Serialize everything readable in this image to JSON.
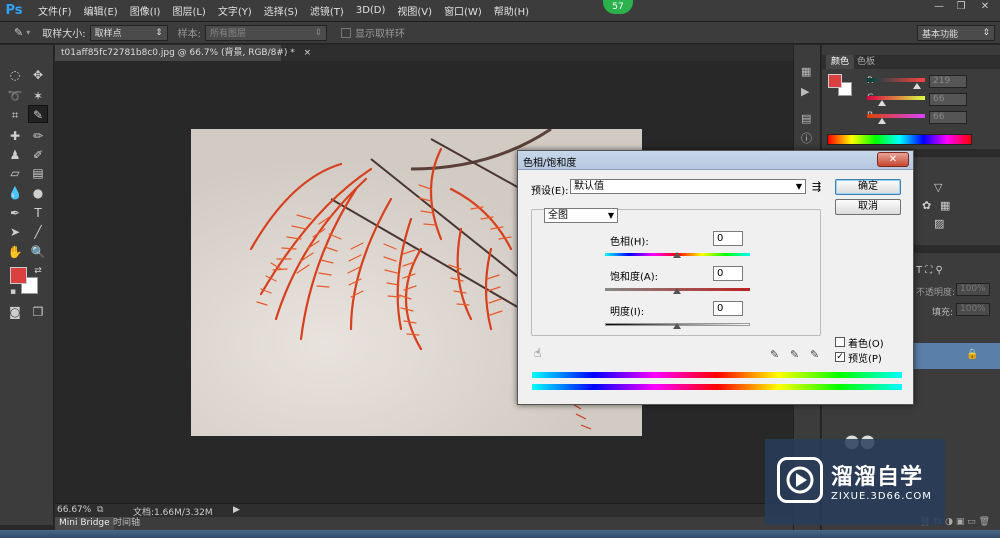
{
  "menubar": {
    "app_logo": "Ps",
    "items": [
      "文件(F)",
      "编辑(E)",
      "图像(I)",
      "图层(L)",
      "文字(Y)",
      "选择(S)",
      "滤镜(T)",
      "3D(D)",
      "视图(V)",
      "窗口(W)",
      "帮助(H)"
    ],
    "perf_badge": "57",
    "win_minimize": "—",
    "win_maximize": "❐",
    "win_close": "✕"
  },
  "options_bar": {
    "sample_size_label": "取样大小:",
    "sample_size_value": "取样点",
    "sample_label": "样本:",
    "sample_value": "所有图层",
    "show_ring_label": "显示取样环",
    "workspace_value": "基本功能"
  },
  "document": {
    "tab_title": "t01aff85fc72781b8c0.jpg @ 66.7% (背景, RGB/8#) *",
    "tab_close": "×"
  },
  "statusbar": {
    "zoom": "66.67%",
    "doc_info": "文档:1.66M/3.32M",
    "arrow": "▶"
  },
  "bottom_tabs": {
    "mini_bridge": "Mini Bridge",
    "timeline": "时间轴"
  },
  "color_panel": {
    "tab_color": "颜色",
    "tab_swatches": "色板",
    "r_label": "R",
    "g_label": "G",
    "b_label": "B",
    "r_value": "219",
    "g_value": "66",
    "b_value": "66",
    "r_level": 0.86,
    "g_level": 0.26,
    "b_level": 0.26,
    "foreground_color": "#d9403f"
  },
  "layers_panel": {
    "opacity_label": "不透明度:",
    "opacity_value": "100%",
    "fill_label": "填充:",
    "fill_value": "100%"
  },
  "dialog": {
    "title": "色相/饱和度",
    "close": "✕",
    "preset_label": "预设(E):",
    "preset_value": "默认值",
    "channel_value": "全图",
    "hue_label": "色相(H):",
    "hue_value": "0",
    "saturation_label": "饱和度(A):",
    "saturation_value": "0",
    "lightness_label": "明度(I):",
    "lightness_value": "0",
    "ok_label": "确定",
    "cancel_label": "取消",
    "colorize_label": "着色(O)",
    "colorize_checked": false,
    "preview_label": "预览(P)",
    "preview_checked": true,
    "preview_check_mark": "✓"
  },
  "watermark": {
    "title": "溜溜自学",
    "subtitle": "ZIXUE.3D66.COM"
  }
}
